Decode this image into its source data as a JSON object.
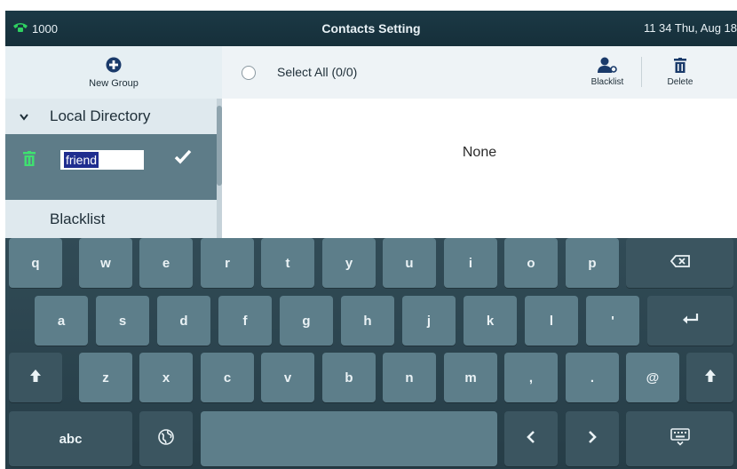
{
  "status_bar": {
    "extension": "1000",
    "title": "Contacts Setting",
    "datetime": "11 34 Thu, Aug 18"
  },
  "left_panel": {
    "new_group_label": "New Group",
    "local_directory_label": "Local Directory",
    "edit_group_value": "friend",
    "blacklist_label": "Blacklist"
  },
  "right_panel": {
    "select_all_label": "Select All (0/0)",
    "blacklist_button_label": "Blacklist",
    "delete_button_label": "Delete",
    "empty_text": "None"
  },
  "keyboard": {
    "row1": [
      "q",
      "w",
      "e",
      "r",
      "t",
      "y",
      "u",
      "i",
      "o",
      "p"
    ],
    "row2": [
      "a",
      "s",
      "d",
      "f",
      "g",
      "h",
      "j",
      "k",
      "l",
      "'"
    ],
    "row3": [
      "z",
      "x",
      "c",
      "v",
      "b",
      "n",
      "m",
      ",",
      ".",
      "@"
    ],
    "abc_label": "abc"
  },
  "colors": {
    "status_bar": "#1b3945",
    "key": "#5d7e8a",
    "key_dark": "#3b5560",
    "keyboard_bg": "#2c4550",
    "accent_green": "#2fd160",
    "accent_navy": "#1a3a6a"
  }
}
